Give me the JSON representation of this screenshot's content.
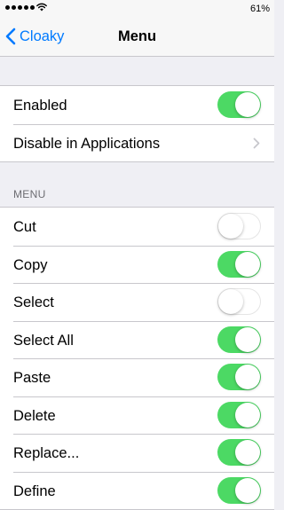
{
  "status_bar": {
    "battery": "61%",
    "signal_icon": "signal-dots-icon",
    "wifi_icon": "wifi-icon"
  },
  "nav": {
    "back_label": "Cloaky",
    "title": "Menu",
    "back_icon": "chevron-left-icon"
  },
  "colors": {
    "accent": "#007aff",
    "toggle_on": "#4cd964",
    "background": "#efeff4"
  },
  "general": {
    "items": [
      {
        "label": "Enabled",
        "control": "toggle",
        "on": true
      },
      {
        "label": "Disable in Applications",
        "control": "disclosure",
        "icon": "chevron-right-icon"
      }
    ]
  },
  "menu_section": {
    "header": "MENU",
    "items": [
      {
        "label": "Cut",
        "on": false
      },
      {
        "label": "Copy",
        "on": true
      },
      {
        "label": "Select",
        "on": false
      },
      {
        "label": "Select All",
        "on": true
      },
      {
        "label": "Paste",
        "on": true
      },
      {
        "label": "Delete",
        "on": true
      },
      {
        "label": "Replace...",
        "on": true
      },
      {
        "label": "Define",
        "on": true
      }
    ]
  }
}
